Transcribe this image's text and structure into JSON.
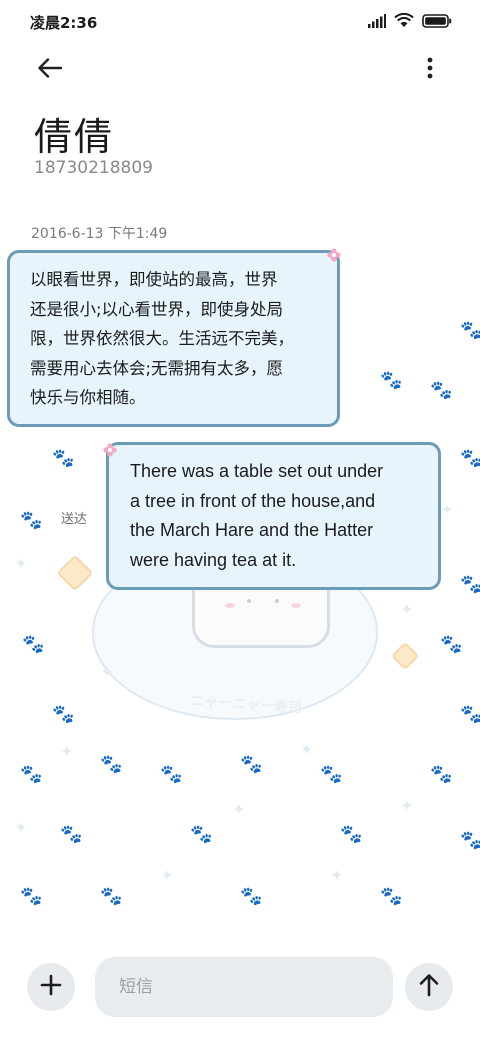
{
  "status_bar": {
    "time": "凌晨2:36",
    "icons": [
      "signal-icon",
      "wifi-icon",
      "battery-icon"
    ]
  },
  "toolbar": {
    "back_icon": "arrow-left-icon",
    "more_icon": "more-vertical-icon"
  },
  "contact": {
    "name": "倩倩",
    "number": "18730218809"
  },
  "conversation": {
    "timestamp": "2016-6-13 下午1:49",
    "messages": [
      {
        "direction": "incoming",
        "lines": [
          "以眼看世界，即使站的最高，世界",
          "还是很小;以心看世界，即使身处局",
          "限，世界依然很大。生活远不完美，",
          "需要用心去体会;无需拥有太多，愿",
          "快乐与你相随。"
        ]
      },
      {
        "direction": "outgoing",
        "lines": [
          "There was a table set out under",
          "a tree in front of the house,and",
          "the March Hare and the Hatter",
          "were having tea at it."
        ],
        "status": "送达"
      }
    ]
  },
  "composer": {
    "add_icon": "plus-icon",
    "placeholder": "短信",
    "value": "",
    "send_icon": "arrow-up-icon"
  },
  "colors": {
    "bubble_bg": "#e8f4fb",
    "bubble_border": "#6a9bb8",
    "accent_pink": "#f08bb0"
  }
}
